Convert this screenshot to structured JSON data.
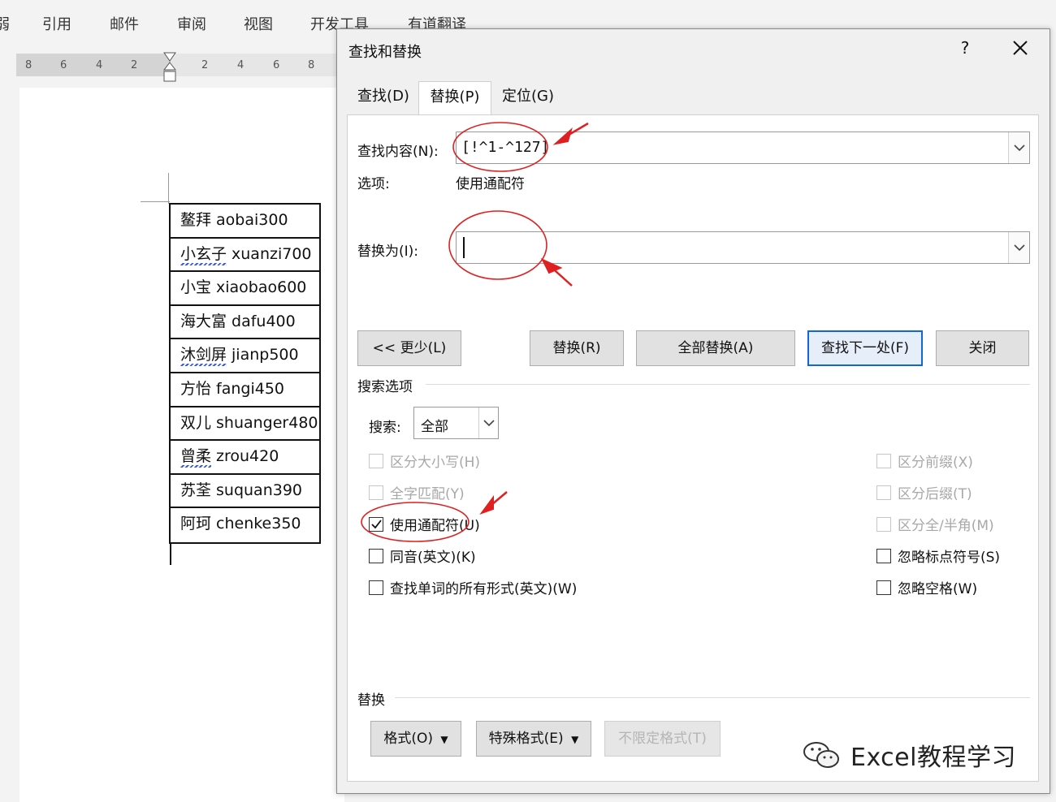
{
  "ribbon": {
    "tabs": [
      "弱",
      "引用",
      "邮件",
      "审阅",
      "视图",
      "开发工具",
      "有道翻译"
    ]
  },
  "ruler": {
    "ticks": [
      "8",
      "6",
      "4",
      "2",
      "2",
      "4",
      "6",
      "8"
    ]
  },
  "document": {
    "names": [
      {
        "cn": "鳌拜",
        "py": "aobai300",
        "flagged": false
      },
      {
        "cn": "小玄子",
        "py": "xuanzi700",
        "flagged": true
      },
      {
        "cn": "小宝",
        "py": "xiaobao600",
        "flagged": false
      },
      {
        "cn": "海大富",
        "py": "dafu400",
        "flagged": false
      },
      {
        "cn": "沐剑屏",
        "py": "jianp500",
        "flagged": true
      },
      {
        "cn": "方怡",
        "py": "fangi450",
        "flagged": false
      },
      {
        "cn": "双儿",
        "py": "shuanger480",
        "flagged": false
      },
      {
        "cn": "曾柔",
        "py": "zrou420",
        "flagged": true
      },
      {
        "cn": "苏荃",
        "py": "suquan390",
        "flagged": false
      },
      {
        "cn": "阿珂",
        "py": "chenke350",
        "flagged": false
      }
    ]
  },
  "dialog": {
    "title": "查找和替换",
    "help": "?",
    "tabs": [
      {
        "label": "查找(D)",
        "active": false
      },
      {
        "label": "替换(P)",
        "active": true
      },
      {
        "label": "定位(G)",
        "active": false
      }
    ],
    "find": {
      "label": "查找内容(N):",
      "value": "[!^1-^127]"
    },
    "options": {
      "label": "选项:",
      "value": "使用通配符"
    },
    "replace": {
      "label": "替换为(I):",
      "value": ""
    },
    "buttons": {
      "less": "<< 更少(L)",
      "replace": "替换(R)",
      "replace_all": "全部替换(A)",
      "find_next": "查找下一处(F)",
      "close": "关闭"
    },
    "search_options": {
      "title": "搜索选项",
      "search_label": "搜索:",
      "search_value": "全部",
      "left": [
        {
          "label": "区分大小写(H)",
          "checked": false,
          "disabled": true
        },
        {
          "label": "全字匹配(Y)",
          "checked": false,
          "disabled": true
        },
        {
          "label": "使用通配符(U)",
          "checked": true,
          "disabled": false
        },
        {
          "label": "同音(英文)(K)",
          "checked": false,
          "disabled": false
        },
        {
          "label": "查找单词的所有形式(英文)(W)",
          "checked": false,
          "disabled": false
        }
      ],
      "right": [
        {
          "label": "区分前缀(X)",
          "checked": false,
          "disabled": true
        },
        {
          "label": "区分后缀(T)",
          "checked": false,
          "disabled": true
        },
        {
          "label": "区分全/半角(M)",
          "checked": false,
          "disabled": true
        },
        {
          "label": "忽略标点符号(S)",
          "checked": false,
          "disabled": false
        },
        {
          "label": "忽略空格(W)",
          "checked": false,
          "disabled": false
        }
      ]
    },
    "replace_section": {
      "title": "替换",
      "format": "格式(O)",
      "special": "特殊格式(E)",
      "no_format": "不限定格式(T)"
    }
  },
  "watermark": {
    "text": "Excel教程学习"
  },
  "colors": {
    "annotation": "#e02020",
    "accent": "#0f68d6"
  }
}
